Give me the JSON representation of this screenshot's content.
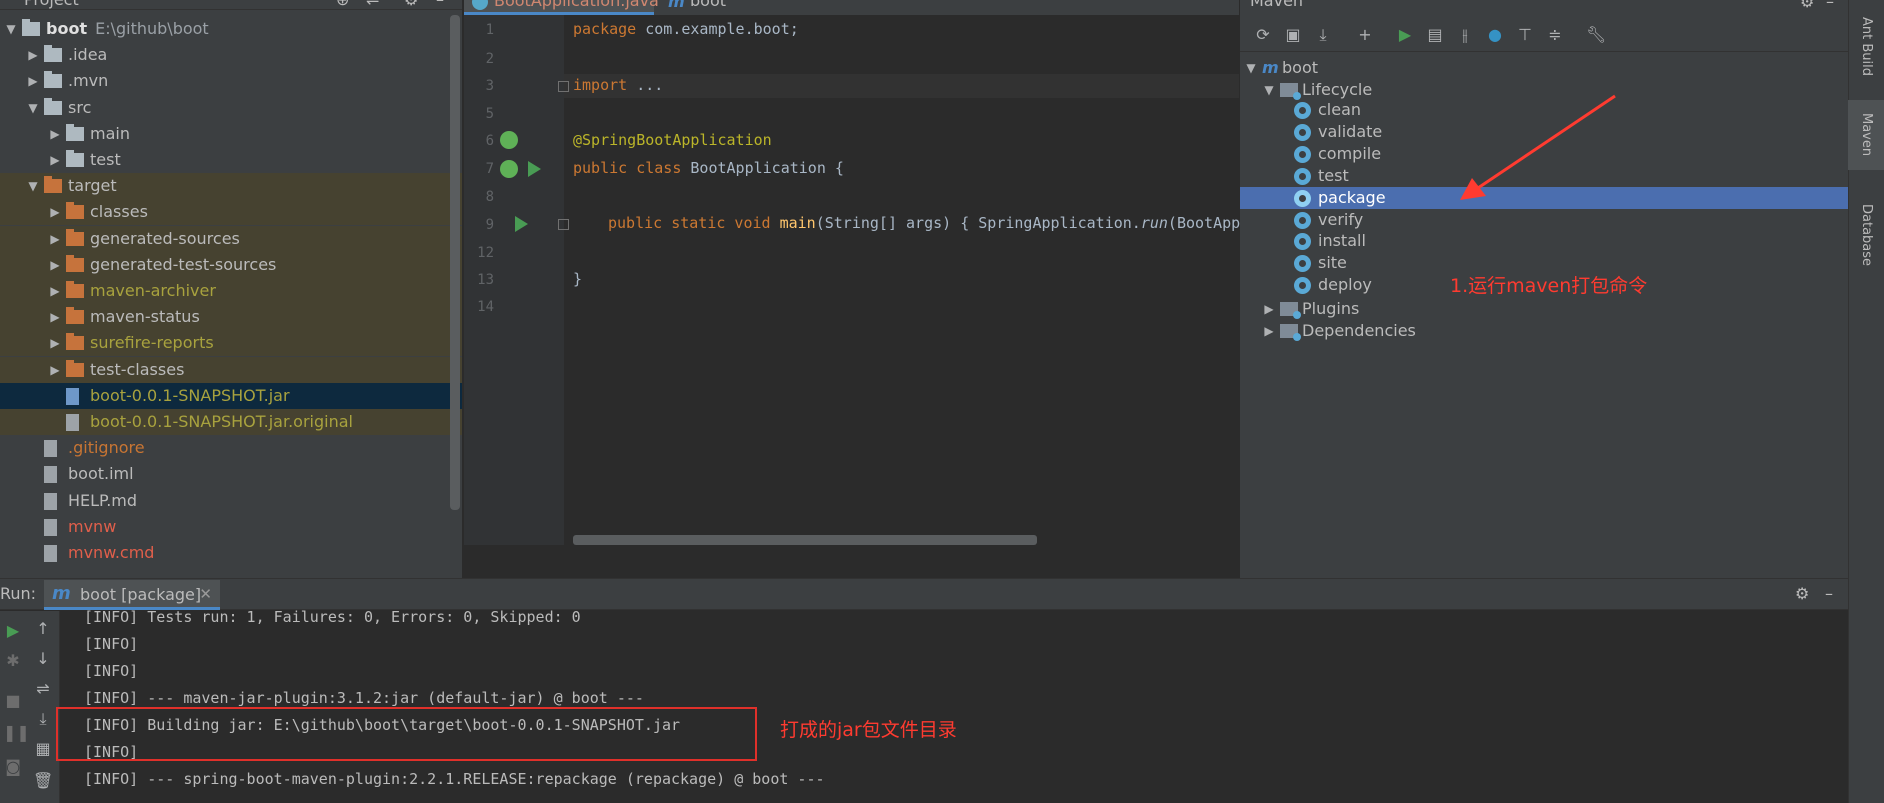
{
  "project": {
    "title": "Project",
    "root": {
      "name": "boot",
      "path": "E:\\github\\boot"
    },
    "items": [
      {
        "label": ".idea",
        "color": "def",
        "type": "folder-gray"
      },
      {
        "label": ".mvn",
        "color": "def",
        "type": "folder-gray"
      },
      {
        "label": "src",
        "color": "def",
        "type": "folder-gray"
      },
      {
        "label": "main",
        "color": "def",
        "type": "folder-gray"
      },
      {
        "label": "test",
        "color": "def",
        "type": "folder-gray"
      },
      {
        "label": "target",
        "color": "def",
        "type": "folder-orange"
      },
      {
        "label": "classes",
        "color": "def",
        "type": "folder-orange"
      },
      {
        "label": "generated-sources",
        "color": "def",
        "type": "folder-orange"
      },
      {
        "label": "generated-test-sources",
        "color": "def",
        "type": "folder-orange"
      },
      {
        "label": "maven-archiver",
        "color": "olive",
        "type": "folder-orange"
      },
      {
        "label": "maven-status",
        "color": "def",
        "type": "folder-orange"
      },
      {
        "label": "surefire-reports",
        "color": "olive",
        "type": "folder-orange"
      },
      {
        "label": "test-classes",
        "color": "def",
        "type": "folder-orange"
      },
      {
        "label": "boot-0.0.1-SNAPSHOT.jar",
        "color": "olive",
        "type": "jar"
      },
      {
        "label": "boot-0.0.1-SNAPSHOT.jar.original",
        "color": "olive",
        "type": "file"
      },
      {
        "label": ".gitignore",
        "color": "orange",
        "type": "file"
      },
      {
        "label": "boot.iml",
        "color": "def",
        "type": "file"
      },
      {
        "label": "HELP.md",
        "color": "def",
        "type": "file"
      },
      {
        "label": "mvnw",
        "color": "red",
        "type": "file"
      },
      {
        "label": "mvnw.cmd",
        "color": "red",
        "type": "file"
      }
    ]
  },
  "editor": {
    "tabs": [
      {
        "label": "BootApplication.java"
      },
      {
        "label": "boot"
      }
    ],
    "line_numbers": [
      "1",
      "2",
      "3",
      "5",
      "6",
      "7",
      "8",
      "9",
      "12",
      "13",
      "14"
    ],
    "code": {
      "l1_kw": "package",
      "l1_rest": " com.example.boot;",
      "l3_kw": "import",
      "l3_rest": " ...",
      "l6": "@SpringBootApplication",
      "l7_kw": "public class",
      "l7_rest": " BootApplication {",
      "l9_kw": "public static void",
      "l9_fn": "main",
      "l9_rest1": "(String[] args) { SpringApplication.",
      "l9_run": "run",
      "l9_rest2": "(BootApp",
      "l13": "}"
    }
  },
  "maven": {
    "title": "Maven",
    "root": "boot",
    "lifecycle_label": "Lifecycle",
    "phases": [
      "clean",
      "validate",
      "compile",
      "test",
      "package",
      "verify",
      "install",
      "site",
      "deploy"
    ],
    "selected_phase": "package",
    "plugins_label": "Plugins",
    "dependencies_label": "Dependencies"
  },
  "side_tabs": {
    "ant": "Ant Build",
    "maven": "Maven",
    "database": "Database"
  },
  "run": {
    "label": "Run:",
    "tab_label": "boot [package]",
    "console": [
      "[INFO] Tests run: 1, Failures: 0, Errors: 0, Skipped: 0",
      "[INFO]",
      "[INFO]",
      "[INFO] --- maven-jar-plugin:3.1.2:jar (default-jar) @ boot ---",
      "[INFO] Building jar: E:\\github\\boot\\target\\boot-0.0.1-SNAPSHOT.jar",
      "[INFO]",
      "[INFO] --- spring-boot-maven-plugin:2.2.1.RELEASE:repackage (repackage) @ boot ---"
    ]
  },
  "annotations": {
    "maven_note": "1.运行maven打包命令",
    "jar_note": "打成的jar包文件目录"
  },
  "colors": {
    "accent": "#4a88c7",
    "selection": "#4b6eaf",
    "annotation_red": "#ff3b30"
  }
}
